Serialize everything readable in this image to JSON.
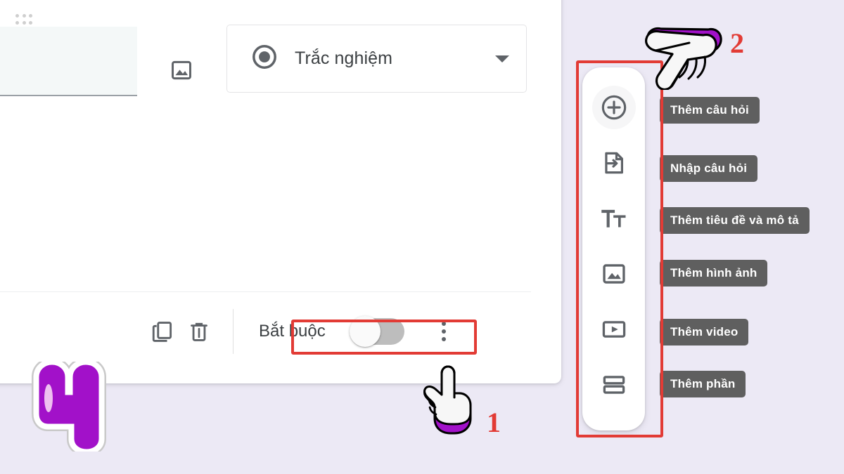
{
  "app": {
    "background_color": "#ece9f5",
    "card_background": "#ffffff",
    "accent_red": "#e23b35",
    "accent_purple": "#a211c9",
    "tooltip_bg": "#5f5f5f"
  },
  "question_card": {
    "drag_handle_icon": "drag-dots-icon",
    "title_input": {
      "value": "",
      "placeholder": ""
    },
    "image_button_icon": "image-icon",
    "type_select": {
      "icon": "radio-button-icon",
      "value": "Trắc nghiệm",
      "caret_icon": "chevron-down-icon"
    },
    "footer": {
      "duplicate_icon": "duplicate-icon",
      "delete_icon": "trash-icon",
      "required_label": "Bắt buộc",
      "required_toggle_state": "off",
      "more_options_icon": "kebab-menu-icon"
    }
  },
  "side_toolbar": {
    "items": [
      {
        "icon": "add-circle-icon",
        "tooltip": "Thêm câu hỏi",
        "active": true
      },
      {
        "icon": "import-file-icon",
        "tooltip": "Nhập câu hỏi",
        "active": false
      },
      {
        "icon": "title-text-icon",
        "tooltip": "Thêm tiêu đề và mô tả",
        "active": false
      },
      {
        "icon": "image-icon",
        "tooltip": "Thêm hình ảnh",
        "active": false
      },
      {
        "icon": "video-icon",
        "tooltip": "Thêm video",
        "active": false
      },
      {
        "icon": "section-icon",
        "tooltip": "Thêm phần",
        "active": false
      }
    ]
  },
  "annotations": {
    "step_one": "1",
    "step_two": "2",
    "badge_number": "4"
  }
}
